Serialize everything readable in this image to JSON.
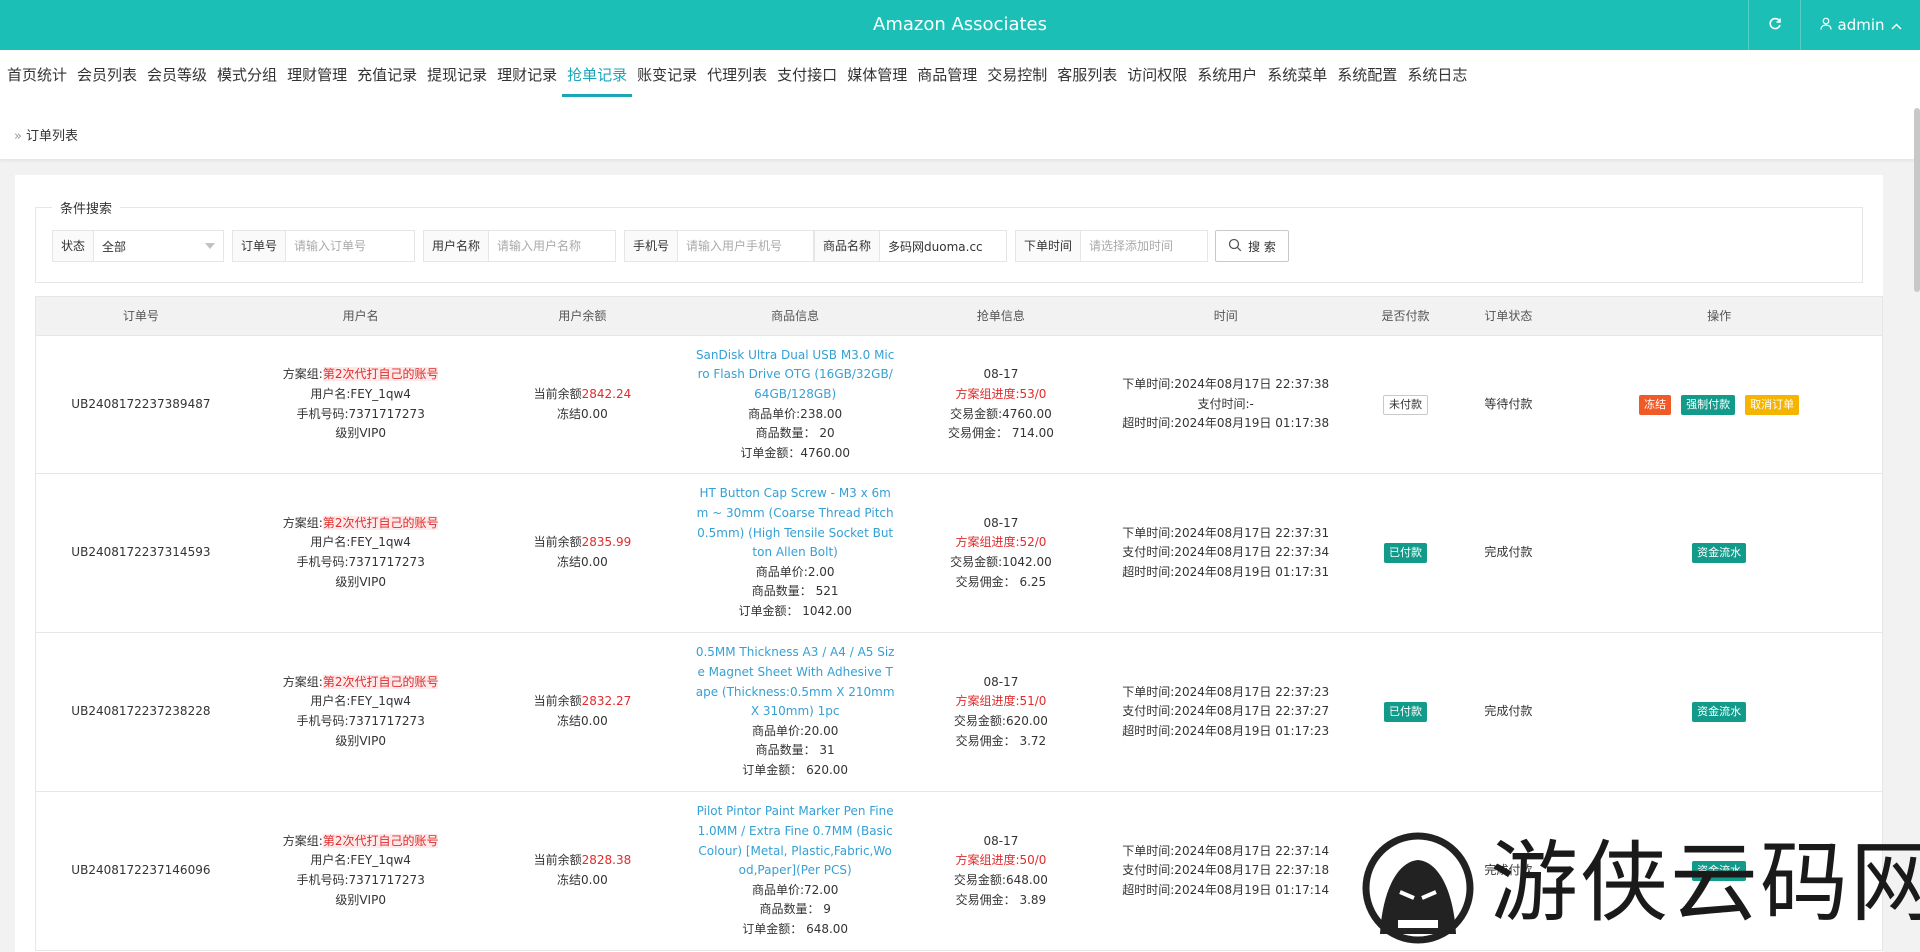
{
  "header": {
    "title": "Amazon Associates",
    "refresh_icon": "refresh-icon",
    "user": "admin"
  },
  "nav": [
    "首页统计",
    "会员列表",
    "会员等级",
    "模式分组",
    "理财管理",
    "充值记录",
    "提现记录",
    "理财记录",
    "抢单记录",
    "账变记录",
    "代理列表",
    "支付接口",
    "媒体管理",
    "商品管理",
    "交易控制",
    "客服列表",
    "访问权限",
    "系统用户",
    "系统菜单",
    "系统配置",
    "系统日志"
  ],
  "nav_active": "抢单记录",
  "breadcrumb": "订单列表",
  "search": {
    "legend": "条件搜索",
    "status_label": "状态",
    "status_value": "全部",
    "order_label": "订单号",
    "order_placeholder": "请输入订单号",
    "username_label": "用户名称",
    "username_placeholder": "请输入用户名称",
    "phone_label": "手机号",
    "phone_placeholder": "请输入用户手机号",
    "product_label": "商品名称",
    "product_value": "多码网duoma.cc",
    "time_label": "下单时间",
    "time_placeholder": "请选择添加时间",
    "button": "搜 索"
  },
  "columns": [
    "订单号",
    "用户名",
    "用户余额",
    "商品信息",
    "抢单信息",
    "时间",
    "是否付款",
    "订单状态",
    "操作"
  ],
  "rows": [
    {
      "order_no": "UB2408172237389487",
      "plan_prefix": "方案组:",
      "plan": "第2次代打自己的账号",
      "username": "用户名:FEY_1qw4",
      "phone": "手机号码:7371717273",
      "level": "级别VIP0",
      "balance_prefix": "当前余额",
      "balance": "2842.24",
      "frozen": "冻结0.00",
      "product": "SanDisk Ultra Dual USB M3.0 Micro Flash Drive OTG (16GB/32GB/64GB/128GB)",
      "unit_price": "商品单价:238.00",
      "qty": "商品数量： 20",
      "amount": "订单金额：4760.00",
      "grab_date": "08-17",
      "progress": "方案组进度:53/0",
      "trade_amount": "交易金额:4760.00",
      "commission": "交易佣金： 714.00",
      "order_time": "下单时间:2024年08月17日 22:37:38",
      "pay_time": "支付时间:-",
      "timeout": "超时时间:2024年08月19日 01:17:38",
      "paid": "未付款",
      "status": "等待付款",
      "ops": [
        "冻结",
        "强制付款",
        "取消订单"
      ]
    },
    {
      "order_no": "UB2408172237314593",
      "plan_prefix": "方案组:",
      "plan": "第2次代打自己的账号",
      "username": "用户名:FEY_1qw4",
      "phone": "手机号码:7371717273",
      "level": "级别VIP0",
      "balance_prefix": "当前余额",
      "balance": "2835.99",
      "frozen": "冻结0.00",
      "product": "HT Button Cap Screw - M3 x 6mm ~ 30mm (Coarse Thread Pitch 0.5mm) (High Tensile Socket Button Allen Bolt)",
      "unit_price": "商品单价:2.00",
      "qty": "商品数量： 521",
      "amount": "订单金额： 1042.00",
      "grab_date": "08-17",
      "progress": "方案组进度:52/0",
      "trade_amount": "交易金额:1042.00",
      "commission": "交易佣金： 6.25",
      "order_time": "下单时间:2024年08月17日 22:37:31",
      "pay_time": "支付时间:2024年08月17日 22:37:34",
      "timeout": "超时时间:2024年08月19日 01:17:31",
      "paid": "已付款",
      "status": "完成付款",
      "ops": [
        "资金流水"
      ]
    },
    {
      "order_no": "UB2408172237238228",
      "plan_prefix": "方案组:",
      "plan": "第2次代打自己的账号",
      "username": "用户名:FEY_1qw4",
      "phone": "手机号码:7371717273",
      "level": "级别VIP0",
      "balance_prefix": "当前余额",
      "balance": "2832.27",
      "frozen": "冻结0.00",
      "product": "0.5MM Thickness A3 / A4 / A5 Size Magnet Sheet With Adhesive Tape (Thickness:0.5mm X 210mm X 310mm) 1pc",
      "unit_price": "商品单价:20.00",
      "qty": "商品数量： 31",
      "amount": "订单金额： 620.00",
      "grab_date": "08-17",
      "progress": "方案组进度:51/0",
      "trade_amount": "交易金额:620.00",
      "commission": "交易佣金： 3.72",
      "order_time": "下单时间:2024年08月17日 22:37:23",
      "pay_time": "支付时间:2024年08月17日 22:37:27",
      "timeout": "超时时间:2024年08月19日 01:17:23",
      "paid": "已付款",
      "status": "完成付款",
      "ops": [
        "资金流水"
      ]
    },
    {
      "order_no": "UB2408172237146096",
      "plan_prefix": "方案组:",
      "plan": "第2次代打自己的账号",
      "username": "用户名:FEY_1qw4",
      "phone": "手机号码:7371717273",
      "level": "级别VIP0",
      "balance_prefix": "当前余额",
      "balance": "2828.38",
      "frozen": "冻结0.00",
      "product": "Pilot Pintor Paint Marker Pen Fine 1.0MM / Extra Fine 0.7MM (Basic Colour) [Metal, Plastic,Fabric,Wood,Paper](Per PCS)",
      "unit_price": "商品单价:72.00",
      "qty": "商品数量： 9",
      "amount": "订单金额： 648.00",
      "grab_date": "08-17",
      "progress": "方案组进度:50/0",
      "trade_amount": "交易金额:648.00",
      "commission": "交易佣金： 3.89",
      "order_time": "下单时间:2024年08月17日 22:37:14",
      "pay_time": "支付时间:2024年08月17日 22:37:18",
      "timeout": "超时时间:2024年08月19日 01:17:14",
      "paid": "已付款",
      "status": "完成付款",
      "ops": [
        "资金流水"
      ]
    }
  ],
  "watermark": "游侠云码网",
  "colors": {
    "header": "#1bbfb6",
    "accent": "#1aa6b9",
    "teal": "#129b8a",
    "orange": "#f05a28",
    "yellow": "#f4b400",
    "red": "#e02c2c",
    "link": "#35a0d4"
  }
}
